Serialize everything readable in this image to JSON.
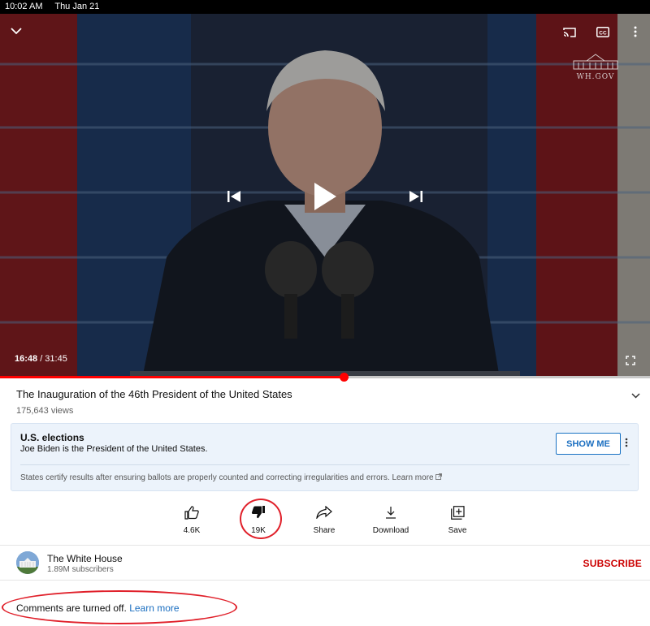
{
  "status_bar": {
    "time": "10:02 AM",
    "date": "Thu Jan 21"
  },
  "player": {
    "current_time": "16:48",
    "duration": " / 31:45",
    "progress_fraction": 0.529,
    "watermark": "WH.GOV",
    "icons": [
      "collapse-chevron-icon",
      "cast-icon",
      "captions-icon",
      "more-vert-icon",
      "previous-icon",
      "play-icon",
      "next-icon",
      "fullscreen-icon"
    ],
    "captions_label": "CC"
  },
  "video": {
    "title": "The Inauguration of the 46th President of the United States",
    "views": "175,643 views"
  },
  "info_panel": {
    "heading": "U.S. elections",
    "subtext": "Joe Biden is the President of the United States.",
    "button": "SHOW ME",
    "footer": "States certify results after ensuring ballots are properly counted and correcting irregularities and errors.",
    "footer_link": "Learn more"
  },
  "actions": [
    {
      "label": "4.6K",
      "icon": "like-icon"
    },
    {
      "label": "19K",
      "icon": "dislike-icon"
    },
    {
      "label": "Share",
      "icon": "share-icon"
    },
    {
      "label": "Download",
      "icon": "download-icon"
    },
    {
      "label": "Save",
      "icon": "save-icon"
    }
  ],
  "channel": {
    "name": "The White House",
    "subscribers": "1.89M subscribers",
    "subscribe": "SUBSCRIBE"
  },
  "comments": {
    "text": "Comments are turned off.",
    "link": "Learn more"
  },
  "colors": {
    "accent_red": "#ff0000",
    "link_blue": "#1a6ec0",
    "annotation_red": "#e0202a"
  }
}
